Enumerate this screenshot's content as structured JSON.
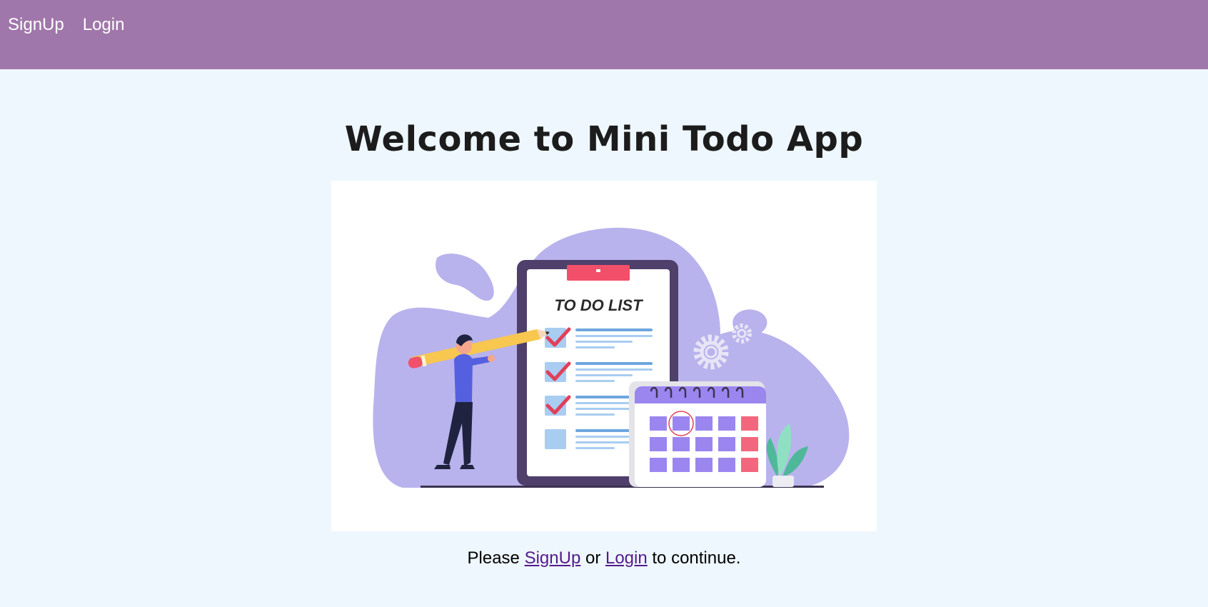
{
  "nav": {
    "signup_label": "SignUp",
    "login_label": "Login"
  },
  "main": {
    "title": "Welcome to Mini Todo App",
    "illustration": {
      "heading": "TO DO LIST",
      "icon": "todo-list-illustration"
    },
    "cta": {
      "prefix": "Please ",
      "signup_link": "SignUp",
      "middle": " or ",
      "login_link": "Login",
      "suffix": " to continue."
    }
  },
  "colors": {
    "navbar": "#a077aa",
    "page_background": "#eef7fe",
    "link": "#551a8b",
    "blob": "#b8b3ec",
    "clipboard": "#4e3f6b",
    "accent_red": "#f2506a",
    "calendar_cell": "#9b86ef"
  }
}
